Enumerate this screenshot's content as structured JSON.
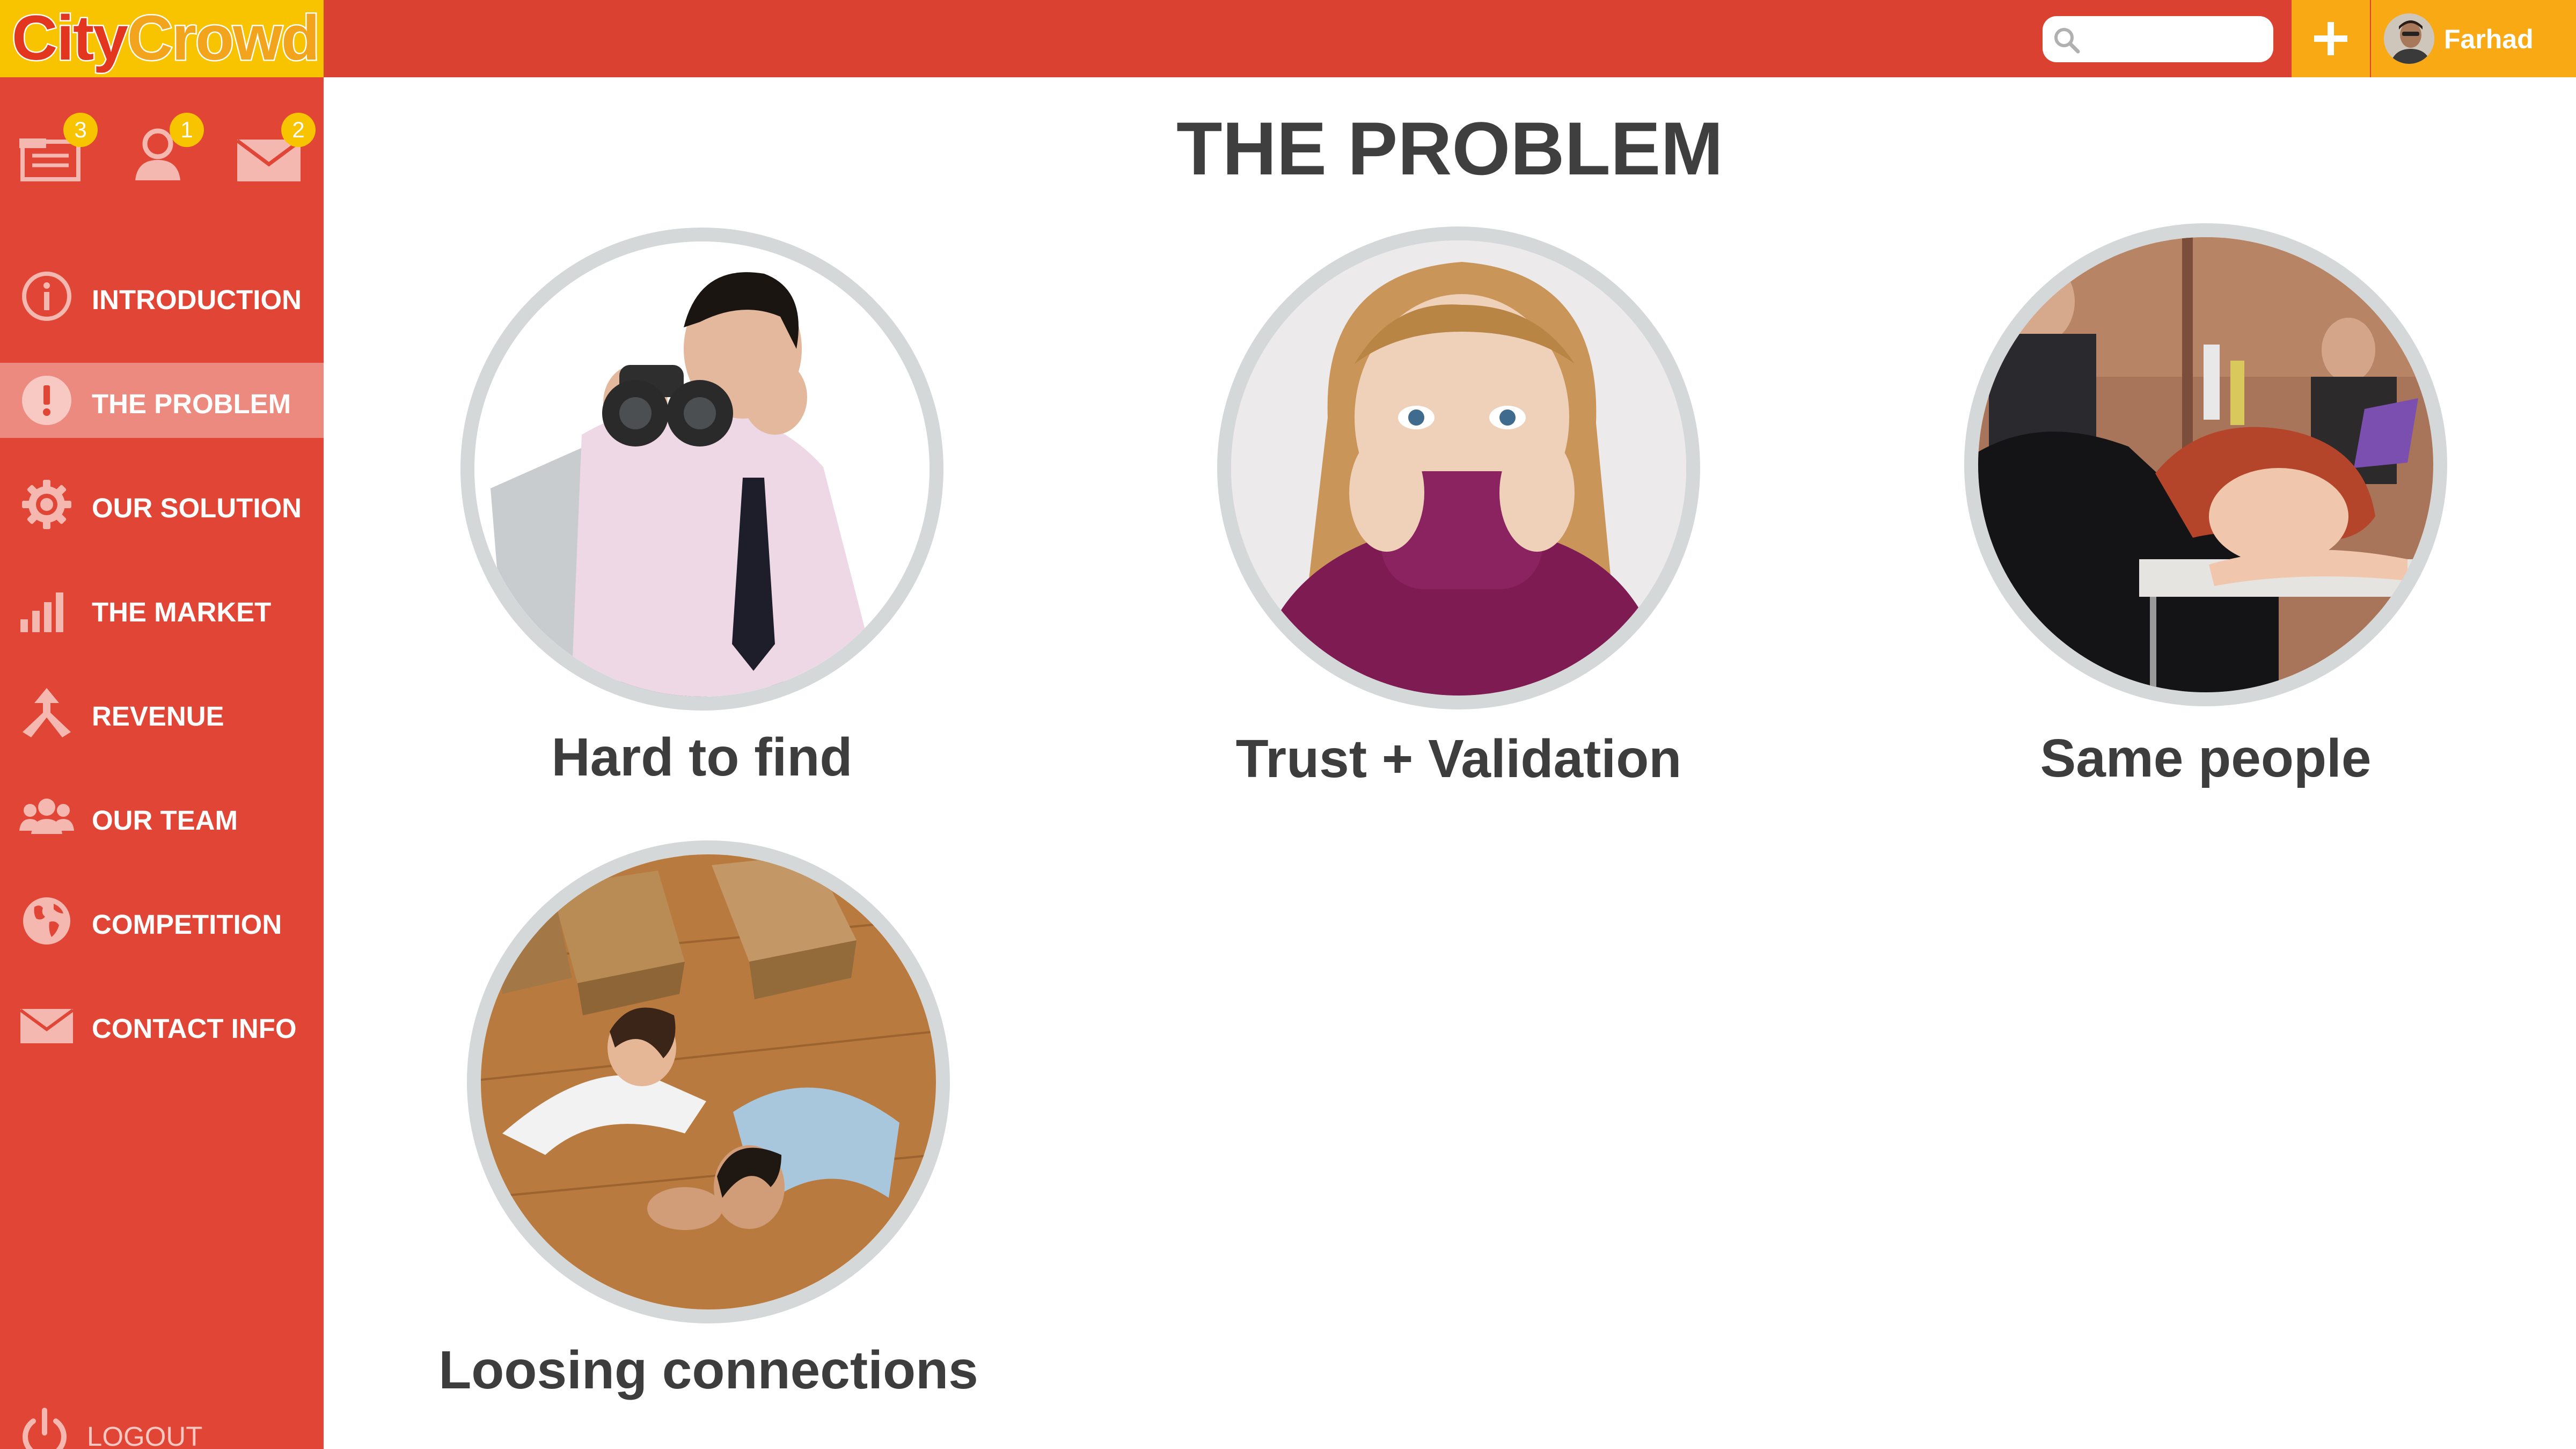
{
  "app": {
    "logo": {
      "part1": "City",
      "part2": "Crowd"
    },
    "colors": {
      "primary": "#db4130",
      "sidebar": "#e04535",
      "accent": "#f8c400",
      "accent_dark": "#f8a914",
      "active_item": "#ed8a7f",
      "text_dark": "#3f3f3f"
    }
  },
  "header": {
    "search": {
      "placeholder": "",
      "value": "",
      "icon": "search-icon"
    },
    "add_button": {
      "icon": "plus-icon"
    },
    "user": {
      "name": "Farhad",
      "icon": "avatar"
    }
  },
  "sidebar": {
    "notifications": [
      {
        "icon": "inbox-icon",
        "count": "3"
      },
      {
        "icon": "user-icon",
        "count": "1"
      },
      {
        "icon": "mail-icon",
        "count": "2"
      }
    ],
    "items": [
      {
        "label": "INTRODUCTION",
        "icon": "info-icon",
        "active": false
      },
      {
        "label": "THE PROBLEM",
        "icon": "alert-icon",
        "active": true
      },
      {
        "label": "OUR SOLUTION",
        "icon": "gear-icon",
        "active": false
      },
      {
        "label": "THE MARKET",
        "icon": "bar-chart-icon",
        "active": false
      },
      {
        "label": "REVENUE",
        "icon": "merge-arrow-icon",
        "active": false
      },
      {
        "label": "OUR TEAM",
        "icon": "team-icon",
        "active": false
      },
      {
        "label": "COMPETITION",
        "icon": "globe-icon",
        "active": false
      },
      {
        "label": "CONTACT INFO",
        "icon": "envelope-icon",
        "active": false
      }
    ],
    "logout": {
      "label": "LOGOUT",
      "icon": "power-icon"
    }
  },
  "main": {
    "title": "THE PROBLEM",
    "cards": [
      {
        "label": "Hard to find",
        "image": "man-with-binoculars-at-laptop"
      },
      {
        "label": "Trust + Validation",
        "image": "worried-woman-in-turtleneck"
      },
      {
        "label": "Same people",
        "image": "bored-woman-at-party-table"
      },
      {
        "label": "Loosing connections",
        "image": "couple-lying-on-floor-with-boxes"
      }
    ]
  }
}
